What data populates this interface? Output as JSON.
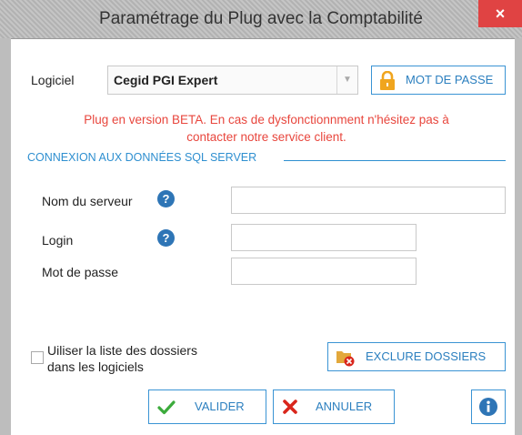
{
  "window": {
    "title": "Paramétrage du Plug avec la Comptabilité",
    "close_label": "×"
  },
  "software": {
    "label": "Logiciel",
    "selected": "Cegid PGI Expert"
  },
  "password_button": {
    "label": "MOT DE PASSE"
  },
  "notice": {
    "line1": "Plug en version BETA. En cas de dysfonctionnment n'hésitez pas à",
    "line2": "contacter notre service client."
  },
  "connection": {
    "section_title": "CONNEXION AUX DONNÉES SQL SERVER",
    "server_label": "Nom du serveur",
    "server_value": "",
    "login_label": "Login",
    "login_value": "",
    "password_label": "Mot de passe",
    "password_value": ""
  },
  "folders": {
    "checkbox_line1": "Uiliser la liste des dossiers",
    "checkbox_line2": "dans les logiciels",
    "checked": false,
    "exclude_button": "EXCLURE DOSSIERS"
  },
  "actions": {
    "validate": "VALIDER",
    "cancel": "ANNULER"
  },
  "colors": {
    "accent": "#2e8fd0",
    "notice": "#e8463d",
    "close": "#e04343",
    "validate_icon": "#3cab3c",
    "cancel_icon": "#d9261c",
    "lock": "#f0a51e"
  }
}
